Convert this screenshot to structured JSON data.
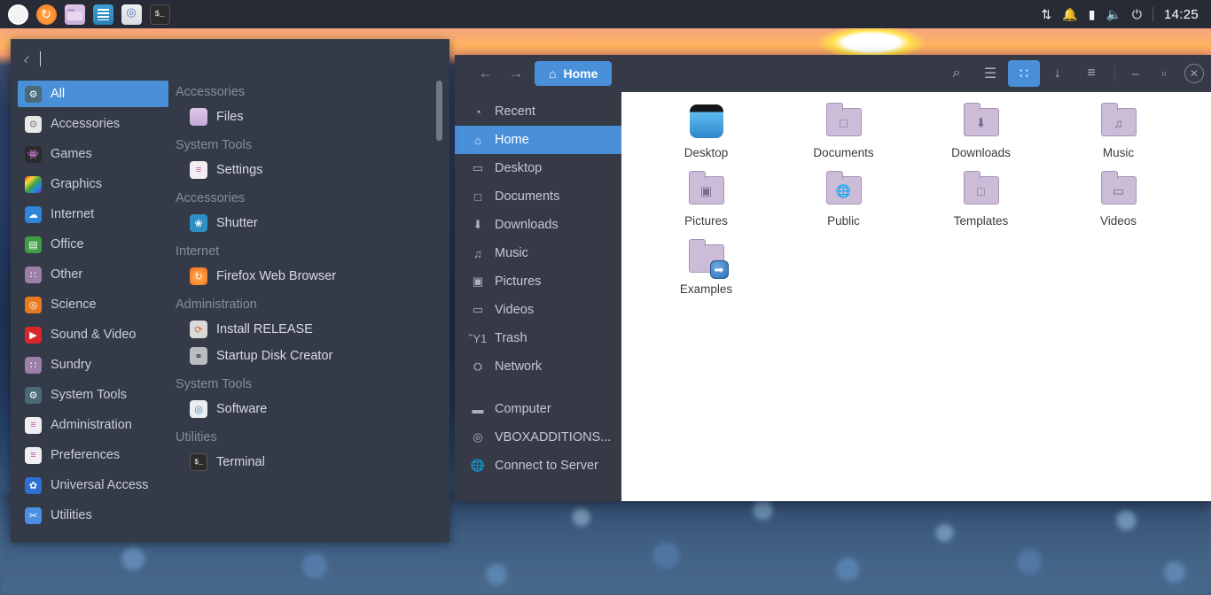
{
  "panel": {
    "dock": [
      {
        "name": "start-button",
        "icon": "circle-white-icon",
        "label": ""
      },
      {
        "name": "firefox",
        "icon": "firefox-icon",
        "label": "↻"
      },
      {
        "name": "files",
        "icon": "folder-icon",
        "label": ""
      },
      {
        "name": "text-editor",
        "icon": "text-editor-icon",
        "label": ""
      },
      {
        "name": "software",
        "icon": "software-center-icon",
        "label": ""
      },
      {
        "name": "terminal",
        "icon": "terminal-icon",
        "label": "$_"
      }
    ],
    "tray": [
      {
        "name": "network-icon",
        "glyph": "⇅"
      },
      {
        "name": "notification-bell-icon",
        "glyph": "🔔"
      },
      {
        "name": "battery-icon",
        "glyph": "▮"
      },
      {
        "name": "volume-icon",
        "glyph": "🔊"
      },
      {
        "name": "power-icon",
        "glyph": "⏻"
      }
    ],
    "clock": "14:25"
  },
  "menu": {
    "search": {
      "placeholder": "",
      "value": ""
    },
    "categories": [
      {
        "label": "All",
        "icon": "gear-icon",
        "glyph": "⚙",
        "bg": "#4a6a78",
        "selected": true
      },
      {
        "label": "Accessories",
        "icon": "gears-icon",
        "glyph": "⚙",
        "bg": "#e8e8e8",
        "fg": "#888"
      },
      {
        "label": "Games",
        "icon": "game-icon",
        "glyph": "👾",
        "bg": "#2a2a2a"
      },
      {
        "label": "Graphics",
        "icon": "graphics-icon",
        "glyph": "",
        "bg": "linear-gradient(135deg,#e53935,#fdd835,#43a047,#1e88e5,#8e24aa)"
      },
      {
        "label": "Internet",
        "icon": "internet-icon",
        "glyph": "☁",
        "bg": "#2f86d8"
      },
      {
        "label": "Office",
        "icon": "office-icon",
        "glyph": "▤",
        "bg": "#3f9e46"
      },
      {
        "label": "Other",
        "icon": "grid-icon",
        "glyph": "∷",
        "bg": "#9c7fa8"
      },
      {
        "label": "Science",
        "icon": "science-icon",
        "glyph": "◎",
        "bg": "#e8791f"
      },
      {
        "label": "Sound & Video",
        "icon": "play-icon",
        "glyph": "▶",
        "bg": "#d9262c"
      },
      {
        "label": "Sundry",
        "icon": "grid-icon",
        "glyph": "∷",
        "bg": "#9c7fa8"
      },
      {
        "label": "System Tools",
        "icon": "gear-icon",
        "glyph": "⚙",
        "bg": "#4a6a78"
      },
      {
        "label": "Administration",
        "icon": "sliders-icon",
        "glyph": "≡",
        "bg": "#f0eef2",
        "fg": "#c455b0"
      },
      {
        "label": "Preferences",
        "icon": "sliders-icon",
        "glyph": "≡",
        "bg": "#f0eef2",
        "fg": "#c455b0"
      },
      {
        "label": "Universal Access",
        "icon": "accessibility-icon",
        "glyph": "✿",
        "bg": "#2f6fd0"
      },
      {
        "label": "Utilities",
        "icon": "scissors-icon",
        "glyph": "✂",
        "bg": "#4a90e2"
      }
    ],
    "groups": [
      {
        "title": "Accessories",
        "apps": [
          {
            "label": "Files",
            "icon": "folder-icon",
            "glyph": "",
            "bg": "linear-gradient(180deg,#ddc8e6,#c5a9d6)"
          }
        ]
      },
      {
        "title": "System Tools",
        "apps": [
          {
            "label": "Settings",
            "icon": "sliders-icon",
            "glyph": "≡",
            "bg": "#f0eef2",
            "fg": "#c455b0"
          }
        ]
      },
      {
        "title": "Accessories",
        "apps": [
          {
            "label": "Shutter",
            "icon": "shutter-icon",
            "glyph": "❀",
            "bg": "#2f8fc4"
          }
        ]
      },
      {
        "title": "Internet",
        "apps": [
          {
            "label": "Firefox Web Browser",
            "icon": "firefox-icon",
            "glyph": "↻",
            "bg": "radial-gradient(circle at 50% 55%, #ff9a3c 0 40%, #e8661e 100%)"
          }
        ]
      },
      {
        "title": "Administration",
        "apps": [
          {
            "label": "Install RELEASE",
            "icon": "install-disc-icon",
            "glyph": "⟳",
            "bg": "#d9d9d9",
            "fg": "#e06424"
          },
          {
            "label": "Startup Disk Creator",
            "icon": "usb-icon",
            "glyph": "⚭",
            "bg": "#b9bcc2",
            "fg": "#444"
          }
        ]
      },
      {
        "title": "System Tools",
        "apps": [
          {
            "label": "Software",
            "icon": "software-center-icon",
            "glyph": "◎",
            "bg": "#ebeef1",
            "fg": "#4a78c0"
          }
        ]
      },
      {
        "title": "Utilities",
        "apps": [
          {
            "label": "Terminal",
            "icon": "terminal-icon",
            "glyph": "$_",
            "bg": "#2b2b2b"
          }
        ]
      }
    ]
  },
  "filemanager": {
    "titlebar": {
      "back_icon": "back-arrow-icon",
      "forward_icon": "forward-arrow-icon",
      "path_label": "Home",
      "path_icon": "home-icon"
    },
    "toolbar": [
      {
        "name": "search-button",
        "icon": "search-icon",
        "glyph": "⌕",
        "active": false
      },
      {
        "name": "list-view-button",
        "icon": "list-view-icon",
        "glyph": "☰",
        "active": false
      },
      {
        "name": "grid-view-button",
        "icon": "grid-view-icon",
        "glyph": "∷",
        "active": true
      },
      {
        "name": "downloads-button",
        "icon": "download-arrow-icon",
        "glyph": "↓",
        "active": false
      },
      {
        "name": "menu-button",
        "icon": "hamburger-menu-icon",
        "glyph": "≡",
        "active": false
      }
    ],
    "window_buttons": [
      {
        "name": "minimize-button",
        "glyph": "–"
      },
      {
        "name": "maximize-button",
        "glyph": "▫"
      },
      {
        "name": "close-button",
        "glyph": "✕"
      }
    ],
    "sidebar": [
      {
        "label": "Recent",
        "icon": "clock-icon",
        "glyph": "◔",
        "selected": false
      },
      {
        "label": "Home",
        "icon": "home-icon",
        "glyph": "⌂",
        "selected": true
      },
      {
        "label": "Desktop",
        "icon": "desktop-icon",
        "glyph": "▭",
        "selected": false
      },
      {
        "label": "Documents",
        "icon": "document-icon",
        "glyph": "□",
        "selected": false
      },
      {
        "label": "Downloads",
        "icon": "download-icon",
        "glyph": "⬇",
        "selected": false
      },
      {
        "label": "Music",
        "icon": "music-note-icon",
        "glyph": "♫",
        "selected": false
      },
      {
        "label": "Pictures",
        "icon": "picture-icon",
        "glyph": "▣",
        "selected": false
      },
      {
        "label": "Videos",
        "icon": "video-camera-icon",
        "glyph": "▭",
        "selected": false
      },
      {
        "label": "Trash",
        "icon": "trash-icon",
        "glyph": "Ὕ1",
        "selected": false
      },
      {
        "label": "Network",
        "icon": "network-icon",
        "glyph": "⛭",
        "selected": false
      },
      {
        "label": "Computer",
        "icon": "computer-icon",
        "glyph": "▬",
        "selected": false,
        "gap_before": true
      },
      {
        "label": "VBOXADDITIONS...",
        "icon": "disc-icon",
        "glyph": "◎",
        "selected": false
      },
      {
        "label": "Connect to Server",
        "icon": "globe-icon",
        "glyph": "🌐",
        "selected": false
      }
    ],
    "files": [
      {
        "label": "Desktop",
        "type": "desktop",
        "emblem": ""
      },
      {
        "label": "Documents",
        "type": "folder",
        "emblem": "□"
      },
      {
        "label": "Downloads",
        "type": "folder",
        "emblem": "⬇"
      },
      {
        "label": "Music",
        "type": "folder",
        "emblem": "♫"
      },
      {
        "label": "Pictures",
        "type": "folder",
        "emblem": "▣"
      },
      {
        "label": "Public",
        "type": "folder",
        "emblem": "🌐"
      },
      {
        "label": "Templates",
        "type": "folder",
        "emblem": "□"
      },
      {
        "label": "Videos",
        "type": "folder",
        "emblem": "▭"
      },
      {
        "label": "Examples",
        "type": "folder",
        "emblem": "",
        "badge": "➡"
      }
    ]
  },
  "colors": {
    "accent": "#4a90d9",
    "panel_bg": "#272b36",
    "menu_bg": "#343a47",
    "fm_chrome": "#353a46",
    "text_light": "#c9ced8"
  }
}
